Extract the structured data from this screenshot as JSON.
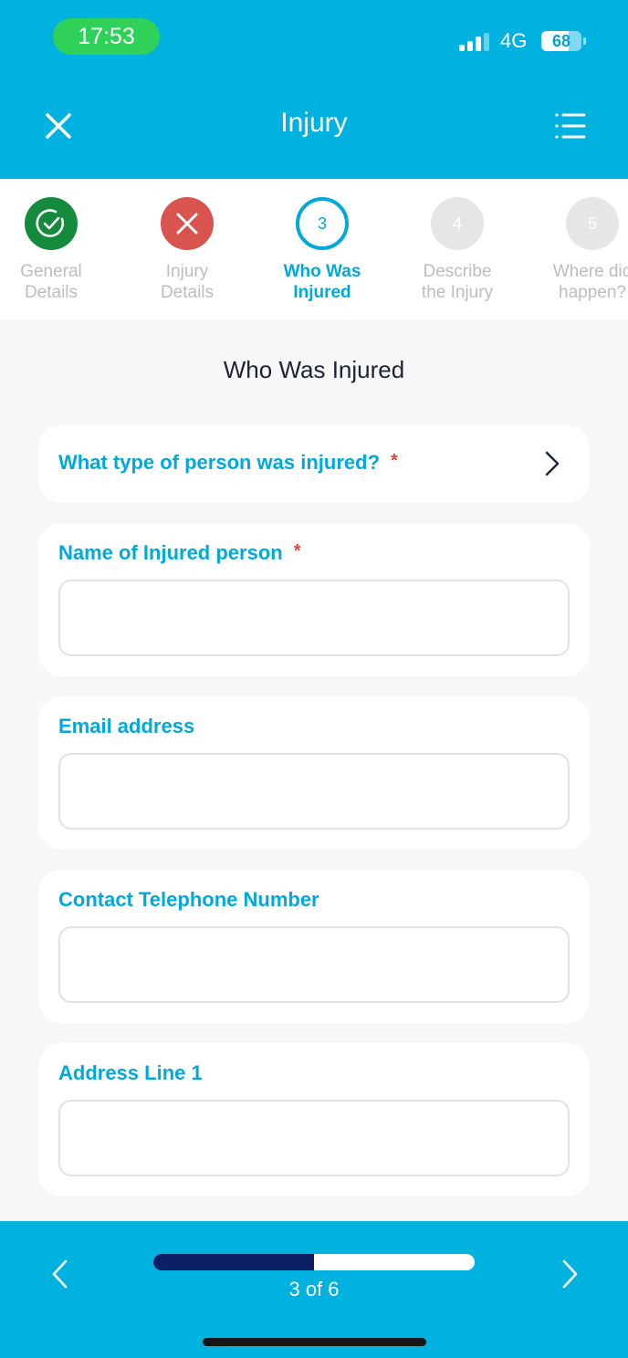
{
  "status_bar": {
    "time": "17:53",
    "network": "4G",
    "battery_level": "68",
    "battery_fraction": 0.68,
    "signal_bars_active": 3,
    "signal_bars_total": 4
  },
  "nav": {
    "title": "Injury",
    "close_icon": "close-icon",
    "menu_icon": "list-menu-icon"
  },
  "steps": [
    {
      "number": "1",
      "label": "General\nDetails",
      "state": "done",
      "icon": "check-circle-icon"
    },
    {
      "number": "2",
      "label": "Injury\nDetails",
      "state": "error",
      "icon": "x-icon"
    },
    {
      "number": "3",
      "label": "Who Was\nInjured",
      "state": "active"
    },
    {
      "number": "4",
      "label": "Describe\nthe Injury",
      "state": "pending"
    },
    {
      "number": "5",
      "label": "Where did\nhappen?",
      "state": "pending"
    }
  ],
  "section": {
    "title": "Who Was Injured"
  },
  "fields": {
    "person_type": {
      "label": "What type of person was injured?",
      "required": "*"
    },
    "name": {
      "label": "Name of Injured person",
      "required": "*",
      "value": ""
    },
    "email": {
      "label": "Email address",
      "value": ""
    },
    "phone": {
      "label": "Contact Telephone Number",
      "value": ""
    },
    "address1": {
      "label": "Address Line 1",
      "value": ""
    }
  },
  "footer": {
    "progress_text": "3 of 6",
    "current_step": 3,
    "total_steps": 6,
    "progress_fraction": 0.5
  },
  "colors": {
    "brand": "#00b2e0",
    "accent": "#00a9d9",
    "done": "#148a3c",
    "error": "#d9534f",
    "required": "#e0463d",
    "progress_fill": "#0b1f62"
  }
}
